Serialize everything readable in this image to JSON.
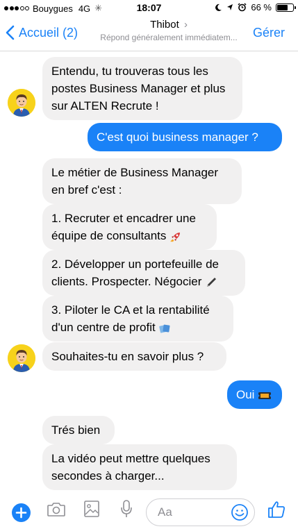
{
  "status_bar": {
    "carrier": "Bouygues",
    "network": "4G",
    "time": "18:07",
    "battery_text": "66 %",
    "battery_level": 0.66,
    "signal_bars_filled": 3,
    "signal_bars_total": 5
  },
  "nav": {
    "back_label": "Accueil (2)",
    "title": "Thibot",
    "title_chevron": "›",
    "subtitle": "Répond généralement immédiatem...",
    "action_label": "Gérer"
  },
  "messages": [
    {
      "side": "in",
      "lines": [
        "Entendu, tu trouveras tous les",
        "postes Business Manager et plus",
        "sur ALTEN Recrute !"
      ]
    },
    {
      "side": "out",
      "lines": [
        "C'est quoi business manager ?"
      ]
    },
    {
      "side": "in",
      "lines": [
        "Le métier de Business Manager",
        "en bref c'est :"
      ]
    },
    {
      "side": "in",
      "lines": [
        "1. Recruter et encadrer une",
        "équipe de consultants"
      ],
      "emoji": "rocket-emoji"
    },
    {
      "side": "in",
      "lines": [
        "2. Développer un portefeuille de",
        "clients. Prospecter. Négocier"
      ],
      "emoji": "pen-emoji"
    },
    {
      "side": "in",
      "lines": [
        "3. Piloter le CA et la rentabilité",
        "d'un centre de profit"
      ],
      "emoji": "money-emoji"
    },
    {
      "side": "in",
      "lines": [
        "Souhaites-tu en savoir plus ?"
      ]
    },
    {
      "side": "out",
      "lines": [
        "Oui"
      ],
      "emoji": "ticket-emoji"
    },
    {
      "side": "in",
      "lines": [
        "Trés bien"
      ]
    },
    {
      "side": "in",
      "lines": [
        "La vidéo peut mettre quelques",
        "secondes à charger..."
      ]
    }
  ],
  "composer": {
    "placeholder": "Aa"
  },
  "colors": {
    "accent": "#1a82f7",
    "incoming_bubble": "#f1f0f0",
    "avatar_bg": "#f7d21b"
  }
}
